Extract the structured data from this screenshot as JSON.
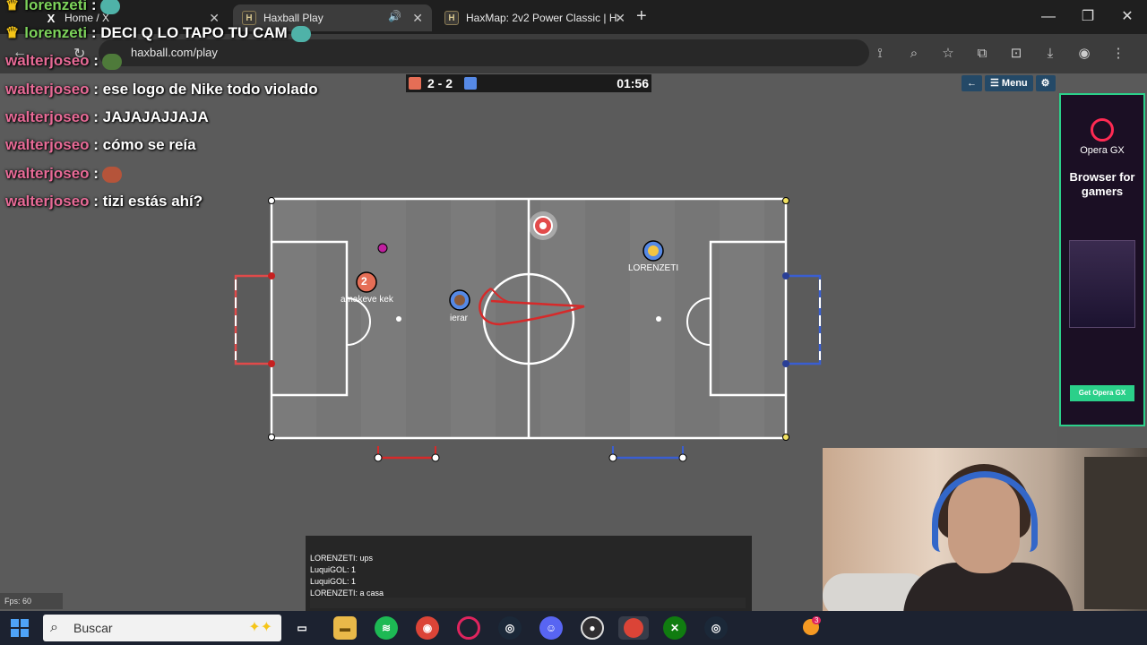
{
  "browser": {
    "tabs": [
      {
        "title": "Home / X",
        "icon": "x-logo-icon",
        "icon_text": "X"
      },
      {
        "title": "Haxball Play",
        "icon": "haxball-icon",
        "icon_text": "H"
      },
      {
        "title": "HaxMap: 2v2 Power Classic | Ha",
        "icon": "haxball-icon",
        "icon_text": "H"
      }
    ],
    "active_tab": 1,
    "new_tab_label": "+",
    "url": "haxball.com/play"
  },
  "stream_chat": [
    {
      "user": "lorenzeti",
      "sep": " :",
      "text": "",
      "emoji": "emote-image",
      "crown": true,
      "color": "#7dd35b"
    },
    {
      "user": "lorenzeti",
      "sep": " :",
      "text": " DECI Q LO TAPO TU CAM",
      "emoji": "emote-image",
      "crown": true,
      "color": "#7dd35b"
    },
    {
      "user": "walterjoseo",
      "sep": " :",
      "text": "",
      "emoji": "emote-image",
      "crown": false,
      "color": "#e76a96"
    },
    {
      "user": "walterjoseo",
      "sep": " :",
      "text": " ese logo de Nike todo violado",
      "crown": false,
      "color": "#e76a96"
    },
    {
      "user": "walterjoseo",
      "sep": " :",
      "text": " JAJAJAJJAJA",
      "crown": false,
      "color": "#e76a96"
    },
    {
      "user": "walterjoseo",
      "sep": " :",
      "text": " cómo se reía",
      "crown": false,
      "color": "#e76a96"
    },
    {
      "user": "walterjoseo",
      "sep": " :",
      "text": "",
      "emoji": "emote-image",
      "crown": false,
      "color": "#e76a96"
    },
    {
      "user": "walterjoseo",
      "sep": " :",
      "text": " tizi estás ahí?",
      "crown": false,
      "color": "#e76a96"
    }
  ],
  "game": {
    "score": "2 - 2",
    "time": "01:56",
    "menu": {
      "back_icon": "arrow-left-icon",
      "menu_label": "☰ Menu",
      "settings_icon": "gear-icon"
    },
    "players": [
      {
        "team": "red",
        "avatar": "2",
        "name": "amakeve kek",
        "color": "#e56e56"
      },
      {
        "team": "blue",
        "avatar": "",
        "name": "ierar",
        "color": "#5689e5"
      },
      {
        "team": "blue",
        "avatar": "",
        "name": "LORENZETI",
        "color": "#5689e5"
      },
      {
        "team": "red",
        "avatar": "",
        "name": "",
        "color": "#e56e56"
      }
    ],
    "chat": [
      {
        "text": "LORENZETI: ups"
      },
      {
        "text": "LuquiGOL: 1"
      },
      {
        "text": "LuquiGOL: 1"
      },
      {
        "text": "LORENZETI: a casa"
      }
    ],
    "fps": "Fps: 60"
  },
  "ad": {
    "brand": "Opera GX",
    "tagline": "Browser for gamers",
    "cta": "Get Opera GX"
  },
  "taskbar": {
    "search_label": "Buscar",
    "apps": [
      "task-view-icon",
      "file-explorer-icon",
      "spotify-icon",
      "chrome-icon",
      "opera-gx-icon",
      "steam-icon",
      "discord-icon",
      "obs-icon",
      "chrome-icon",
      "xbox-icon",
      "steam-icon"
    ],
    "badge_count": "3"
  }
}
